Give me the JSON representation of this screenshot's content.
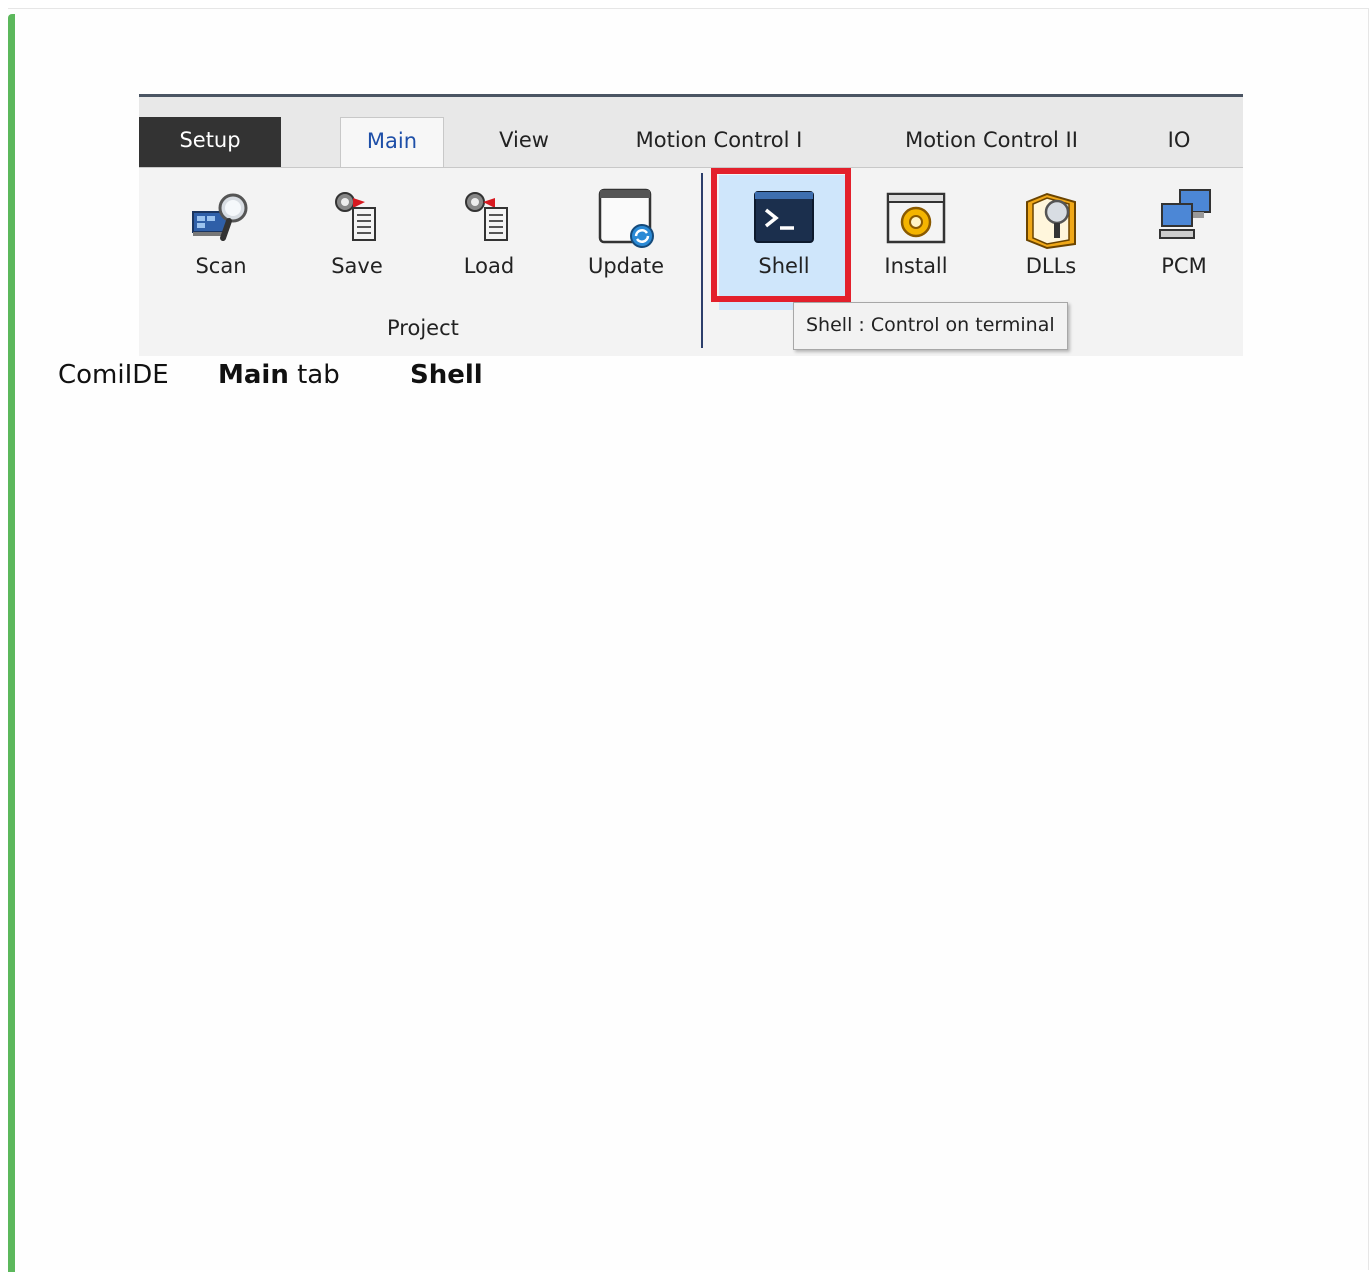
{
  "ribbon": {
    "tabs": [
      {
        "label": "Setup"
      },
      {
        "label": "Main"
      },
      {
        "label": "View"
      },
      {
        "label": "Motion Control I"
      },
      {
        "label": "Motion Control II"
      },
      {
        "label": "IO"
      }
    ],
    "buttons": [
      {
        "label": "Scan",
        "icon": "scan-magnifier-icon"
      },
      {
        "label": "Save",
        "icon": "save-gear-doc-icon"
      },
      {
        "label": "Load",
        "icon": "load-gear-doc-icon"
      },
      {
        "label": "Update",
        "icon": "update-window-icon"
      },
      {
        "label": "Shell",
        "icon": "terminal-icon"
      },
      {
        "label": "Install",
        "icon": "install-gear-icon"
      },
      {
        "label": "DLLs",
        "icon": "dll-book-icon"
      },
      {
        "label": "PCM",
        "icon": "network-computers-icon"
      }
    ],
    "group_label": "Project",
    "tooltip": "Shell : Control on terminal",
    "highlight_color": "#e3202c",
    "active_tab": "Main"
  },
  "caption": {
    "app": "ComiIDE",
    "tab_bold": "Main",
    "tab_word": "tab",
    "button_bold": "Shell"
  },
  "colors": {
    "accent_bar": "#5cb85c",
    "active_tab_text": "#1e4fa8"
  }
}
